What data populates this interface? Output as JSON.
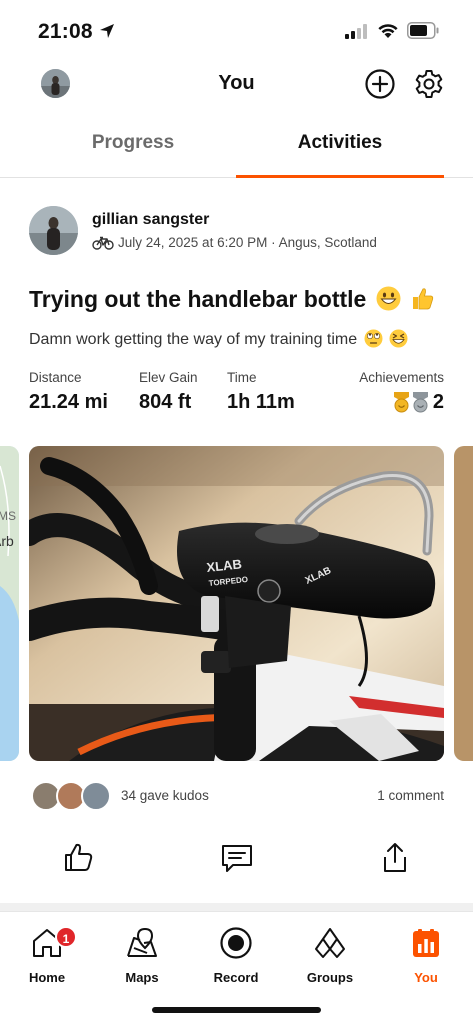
{
  "status_bar": {
    "time": "21:08"
  },
  "header": {
    "title": "You"
  },
  "tabs": [
    {
      "label": "Progress",
      "active": false
    },
    {
      "label": "Activities",
      "active": true
    }
  ],
  "activity": {
    "athlete_name": "gillian sangster",
    "sport_icon": "bike-icon",
    "date_location": "July 24, 2025 at 6:20 PM · Angus, Scotland",
    "title": "Trying out the handlebar bottle",
    "title_emojis": [
      "grinning-face",
      "thumbs-up"
    ],
    "description": "Damn work getting the way of my training time",
    "description_emojis": [
      "rolling-eyes-face",
      "grinning-squinting-face"
    ],
    "stats": [
      {
        "label": "Distance",
        "value": "21.24 mi"
      },
      {
        "label": "Elev Gain",
        "value": "804 ft"
      },
      {
        "label": "Time",
        "value": "1h 11m"
      }
    ],
    "achievements": {
      "label": "Achievements",
      "count": "2",
      "icons": [
        "gold-medal-icon",
        "silver-medal-icon"
      ]
    },
    "map_snippet": {
      "text_1": "MS",
      "text_2": "Arb"
    },
    "photo_text": {
      "brand": "XLAB",
      "model": "TORPEDO",
      "side": "XLAB"
    },
    "kudos_text": "34 gave kudos",
    "comment_text": "1 comment"
  },
  "actions": [
    "kudos-icon",
    "comment-icon",
    "share-icon"
  ],
  "bottom_nav": [
    {
      "label": "Home",
      "icon": "home-icon",
      "badge": "1",
      "active": false
    },
    {
      "label": "Maps",
      "icon": "maps-icon",
      "active": false
    },
    {
      "label": "Record",
      "icon": "record-icon",
      "active": false
    },
    {
      "label": "Groups",
      "icon": "groups-icon",
      "active": false
    },
    {
      "label": "You",
      "icon": "you-icon",
      "active": true
    }
  ],
  "colors": {
    "accent": "#fc5200",
    "badge": "#e0262a",
    "text": "#111111",
    "muted": "#6b6b6b"
  }
}
